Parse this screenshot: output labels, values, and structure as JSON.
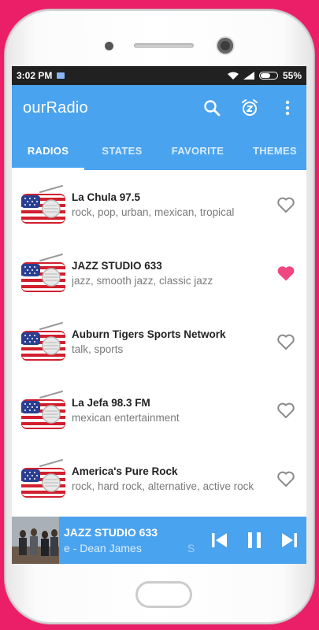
{
  "status_bar": {
    "time": "3:02 PM",
    "battery": "55%"
  },
  "app_bar": {
    "title": "ourRadio",
    "actions": [
      "search-icon",
      "alarm-snooze-icon",
      "more-vert-icon"
    ]
  },
  "tabs": [
    {
      "label": "RADIOS",
      "active": true
    },
    {
      "label": "STATES",
      "active": false
    },
    {
      "label": "FAVORITE",
      "active": false
    },
    {
      "label": "THEMES",
      "active": false
    }
  ],
  "stations": [
    {
      "name": "La Chula 97.5",
      "genres": "rock, pop, urban, mexican, tropical",
      "favorite": false
    },
    {
      "name": "JAZZ STUDIO 633",
      "genres": "jazz, smooth jazz, classic jazz",
      "favorite": true
    },
    {
      "name": "Auburn Tigers Sports Network",
      "genres": "talk, sports",
      "favorite": false
    },
    {
      "name": "La Jefa 98.3 FM",
      "genres": "mexican entertainment",
      "favorite": false
    },
    {
      "name": "America's Pure Rock",
      "genres": "rock, hard rock, alternative, active rock",
      "favorite": false
    }
  ],
  "player": {
    "title": "JAZZ STUDIO 633",
    "subtitle": "e - Dean James",
    "subtitle_tail": "S",
    "state": "playing"
  },
  "colors": {
    "brand_blue": "#4aa3ee",
    "frame_pink": "#ea1f68",
    "favorite_heart": "#f0477f",
    "outline_heart": "#8a8a8a"
  }
}
